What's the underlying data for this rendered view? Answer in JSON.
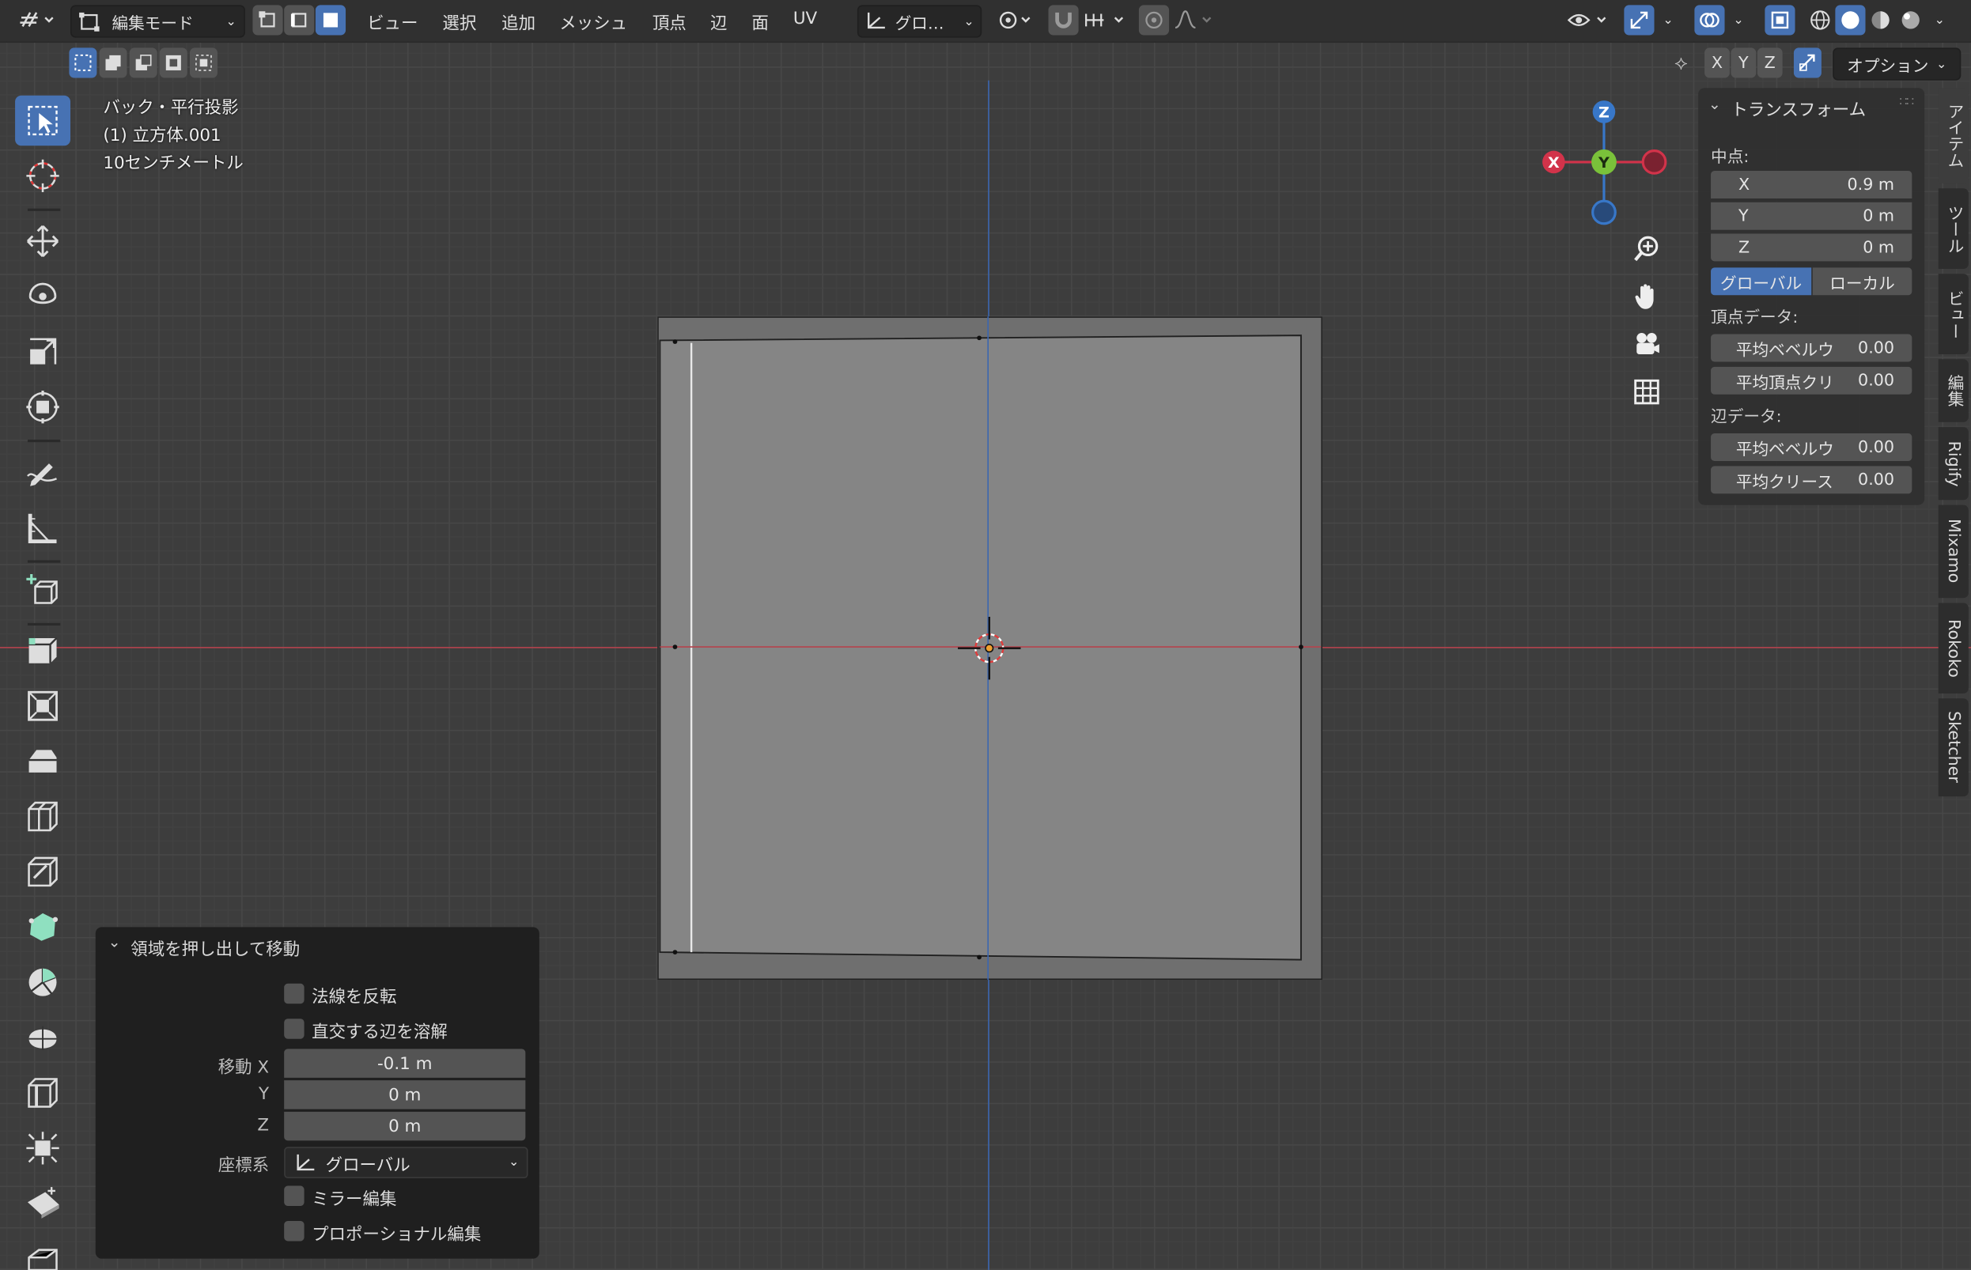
{
  "header": {
    "mode": "編集モード",
    "menu": {
      "view": "ビュー",
      "select": "選択",
      "add": "追加",
      "mesh": "メッシュ",
      "vertex": "頂点",
      "edge": "辺",
      "face": "面",
      "uv": "UV"
    },
    "orientation": "グロ…",
    "axis_x": "X",
    "axis_y": "Y",
    "axis_z": "Z",
    "options": "オプション"
  },
  "viewport": {
    "view_name": "バック・平行投影",
    "object": "(1) 立方体.001",
    "scale": "10センチメートル"
  },
  "gizmo": {
    "x": "X",
    "y": "Y",
    "z": "Z"
  },
  "transform_panel": {
    "title": "トランスフォーム",
    "median_label": "中点:",
    "x_label": "X",
    "x_value": "0.9 m",
    "y_label": "Y",
    "y_value": "0 m",
    "z_label": "Z",
    "z_value": "0 m",
    "global": "グローバル",
    "local": "ローカル",
    "vertex_data": "頂点データ:",
    "v_bevel": "平均ベベルウ",
    "v_bevel_value": "0.00",
    "v_crease": "平均頂点クリ",
    "v_crease_value": "0.00",
    "edge_data": "辺データ:",
    "e_bevel": "平均ベベルウ",
    "e_bevel_value": "0.00",
    "e_crease": "平均クリース",
    "e_crease_value": "0.00"
  },
  "side_tabs": [
    "アイテム",
    "ツール",
    "ビュー",
    "編集",
    "Rigify",
    "Mixamo",
    "Rokoko",
    "Sketcher"
  ],
  "operator_panel": {
    "title": "領域を押し出して移動",
    "flip_normals": "法線を反転",
    "dissolve": "直交する辺を溶解",
    "move_label": "移動 X",
    "move_x": "-0.1 m",
    "y_label": "Y",
    "move_y": "0 m",
    "z_label": "Z",
    "move_z": "0 m",
    "orient_label": "座標系",
    "orient_value": "グローバル",
    "mirror": "ミラー編集",
    "proportional": "プロポーショナル編集"
  },
  "colors": {
    "accent": "#4772b3",
    "x_axis": "#d2334a",
    "y_axis": "#7ac13a",
    "z_axis": "#3877c8"
  }
}
